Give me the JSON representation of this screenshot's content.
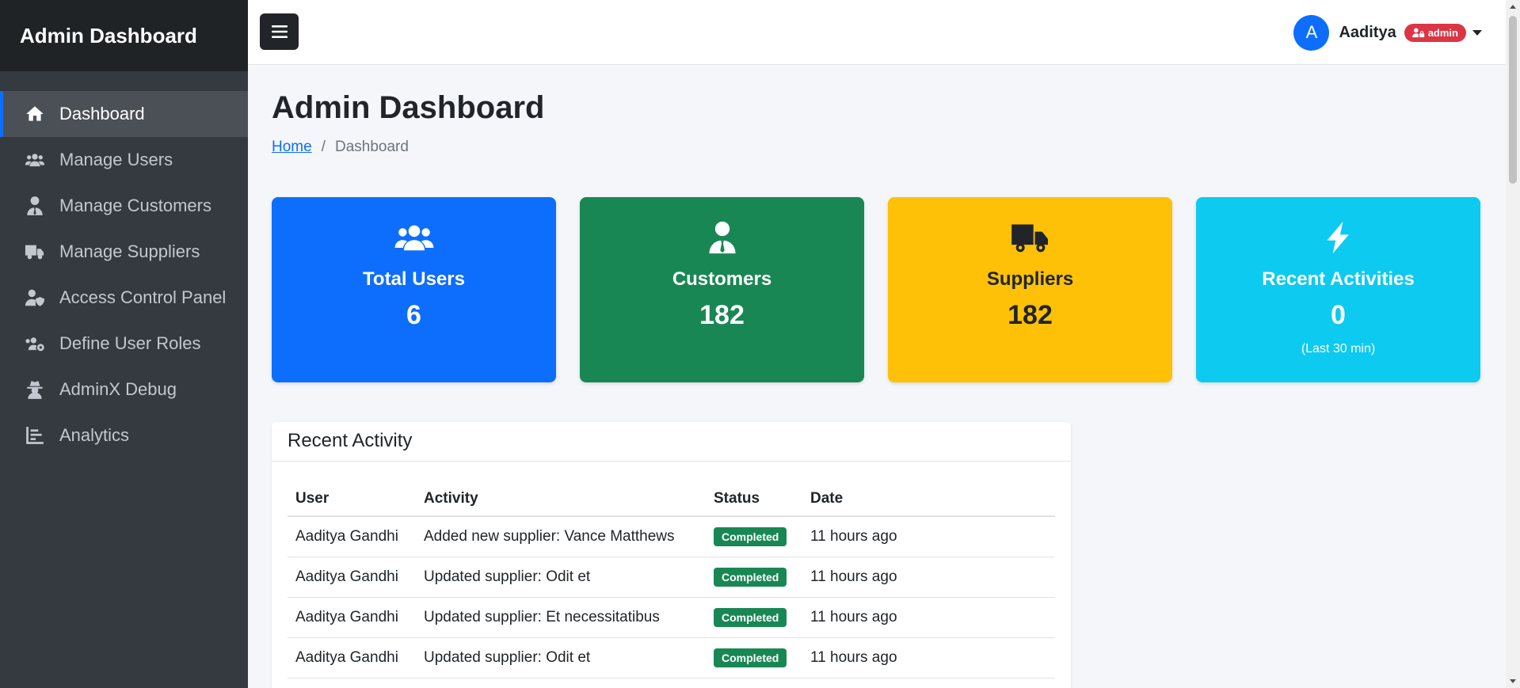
{
  "brand": {
    "title": "Admin Dashboard"
  },
  "sidebar": {
    "items": [
      {
        "label": "Dashboard",
        "icon": "home-icon",
        "active": true
      },
      {
        "label": "Manage Users",
        "icon": "users-icon"
      },
      {
        "label": "Manage Customers",
        "icon": "user-tie-icon"
      },
      {
        "label": "Manage Suppliers",
        "icon": "truck-icon"
      },
      {
        "label": "Access Control Panel",
        "icon": "user-shield-icon"
      },
      {
        "label": "Define User Roles",
        "icon": "users-cog-icon"
      },
      {
        "label": "AdminX Debug",
        "icon": "user-secret-icon"
      },
      {
        "label": "Analytics",
        "icon": "chart-bar-icon"
      }
    ]
  },
  "topbar": {
    "toggle_icon": "hamburger-icon",
    "user": {
      "initial": "A",
      "name": "Aaditya",
      "role": "admin"
    }
  },
  "page": {
    "title": "Admin Dashboard",
    "breadcrumb": {
      "home": "Home",
      "separator": "/",
      "current": "Dashboard"
    }
  },
  "cards": [
    {
      "title": "Total Users",
      "value": "6",
      "note": "",
      "color": "#0d6efd",
      "text_color": "#ffffff",
      "icon": "users-icon"
    },
    {
      "title": "Customers",
      "value": "182",
      "note": "",
      "color": "#198754",
      "text_color": "#ffffff",
      "icon": "user-tie-icon"
    },
    {
      "title": "Suppliers",
      "value": "182",
      "note": "",
      "color": "#ffc107",
      "text_color": "#212529",
      "icon": "truck-icon"
    },
    {
      "title": "Recent Activities",
      "value": "0",
      "note": "(Last 30 min)",
      "color": "#0dcaf0",
      "text_color": "#ffffff",
      "icon": "bolt-icon"
    }
  ],
  "activity": {
    "title": "Recent Activity",
    "columns": [
      "User",
      "Activity",
      "Status",
      "Date"
    ],
    "rows": [
      {
        "user": "Aaditya Gandhi",
        "activity": "Added new supplier: Vance Matthews",
        "status": "Completed",
        "date": "11 hours ago"
      },
      {
        "user": "Aaditya Gandhi",
        "activity": "Updated supplier: Odit et",
        "status": "Completed",
        "date": "11 hours ago"
      },
      {
        "user": "Aaditya Gandhi",
        "activity": "Updated supplier: Et necessitatibus",
        "status": "Completed",
        "date": "11 hours ago"
      },
      {
        "user": "Aaditya Gandhi",
        "activity": "Updated supplier: Odit et",
        "status": "Completed",
        "date": "11 hours ago"
      }
    ]
  },
  "colors": {
    "accent": "#0d6efd",
    "sidebar_bg": "#343a40",
    "danger": "#dc3545",
    "success": "#198754"
  }
}
